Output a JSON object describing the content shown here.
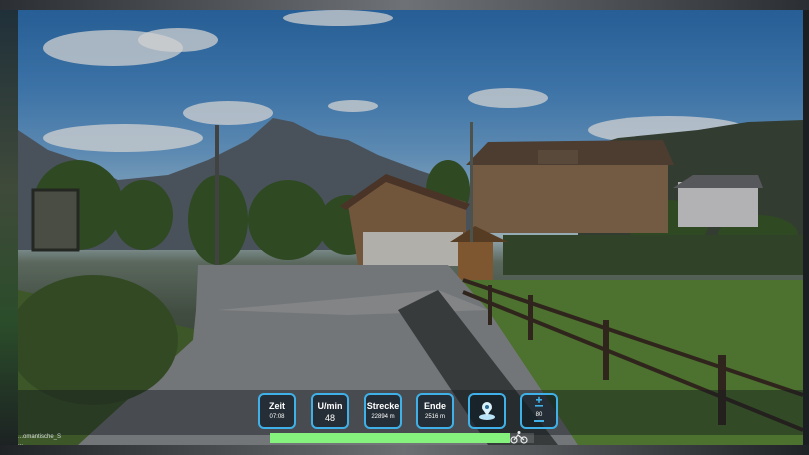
{
  "colors": {
    "accent": "#3fb1e8",
    "progress": "#86f27e"
  },
  "scenario": {
    "name": "...omantische_S",
    "sub": "..."
  },
  "hud": {
    "zeit": {
      "label": "Zeit",
      "value": "07:08"
    },
    "umin": {
      "label": "U/min",
      "value": "48"
    },
    "strecke": {
      "label": "Strecke",
      "value": "22894 m"
    },
    "ende": {
      "label": "Ende",
      "value": "2516 m"
    },
    "map_icon": "map-pin-icon",
    "control": {
      "icon": "plus-minus-icon",
      "value": "80"
    }
  },
  "progress": {
    "fraction": 0.91
  }
}
